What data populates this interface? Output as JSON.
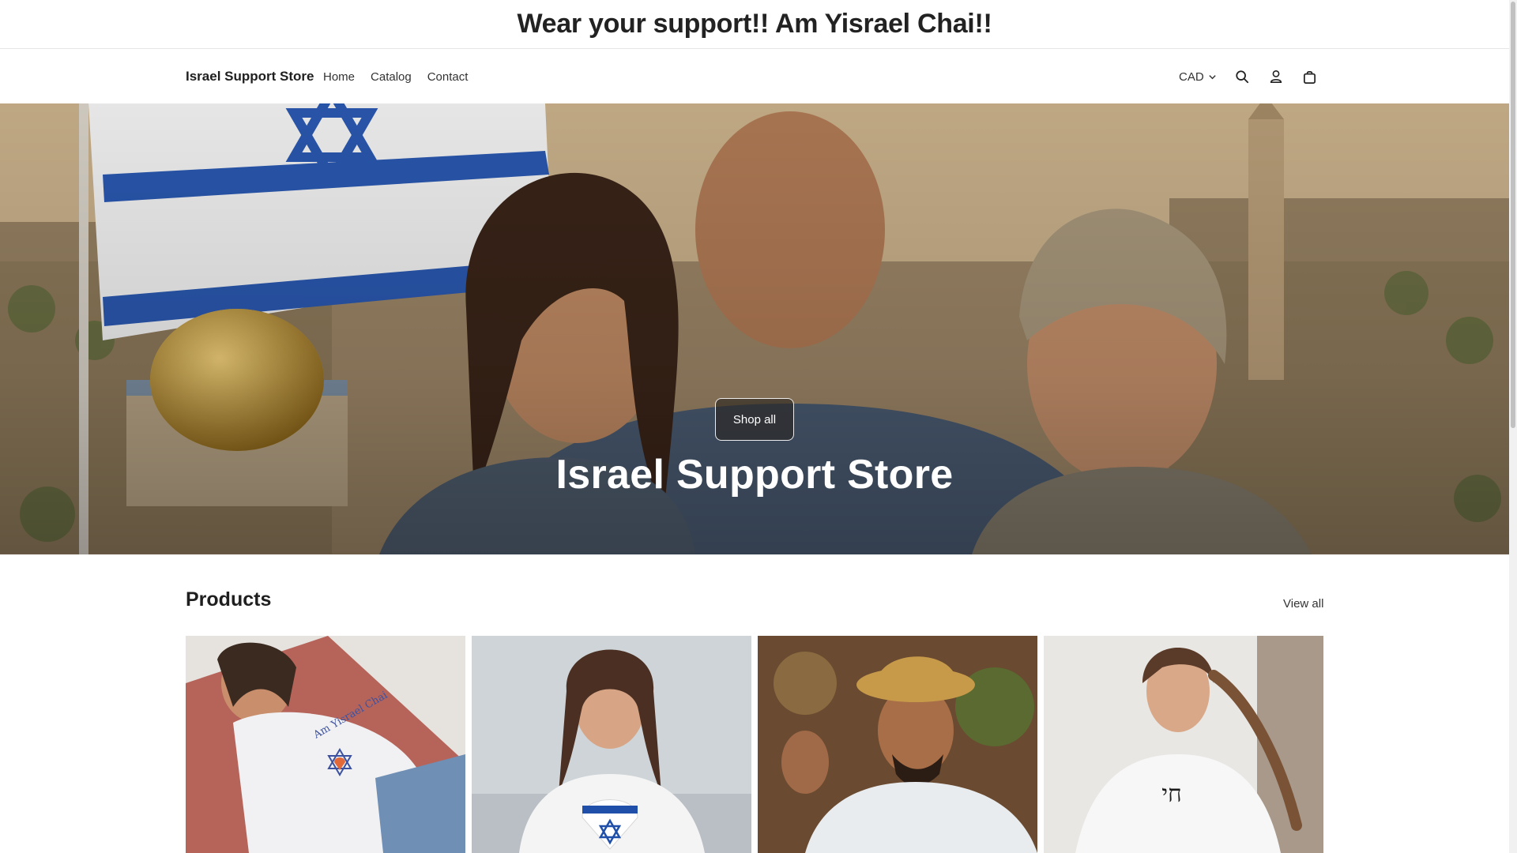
{
  "announcement": {
    "text": "Wear your support!! Am Yisrael Chai!!"
  },
  "header": {
    "brand": "Israel Support Store",
    "nav": [
      {
        "label": "Home"
      },
      {
        "label": "Catalog"
      },
      {
        "label": "Contact"
      }
    ],
    "currency": "CAD",
    "icons": [
      "search-icon",
      "account-icon",
      "cart-icon"
    ]
  },
  "hero": {
    "button_label": "Shop all",
    "title": "Israel Support Store"
  },
  "products": {
    "heading": "Products",
    "view_all_label": "View all",
    "items": [
      {
        "shirt_text": "Am Yisrael Chai"
      },
      {
        "shirt_text": ""
      },
      {
        "shirt_text": ""
      },
      {
        "shirt_text": "חי"
      }
    ]
  },
  "colors": {
    "text": "#1f1f1f",
    "flag_blue": "#1f4fa8",
    "hero_button_border": "#ffffff"
  }
}
